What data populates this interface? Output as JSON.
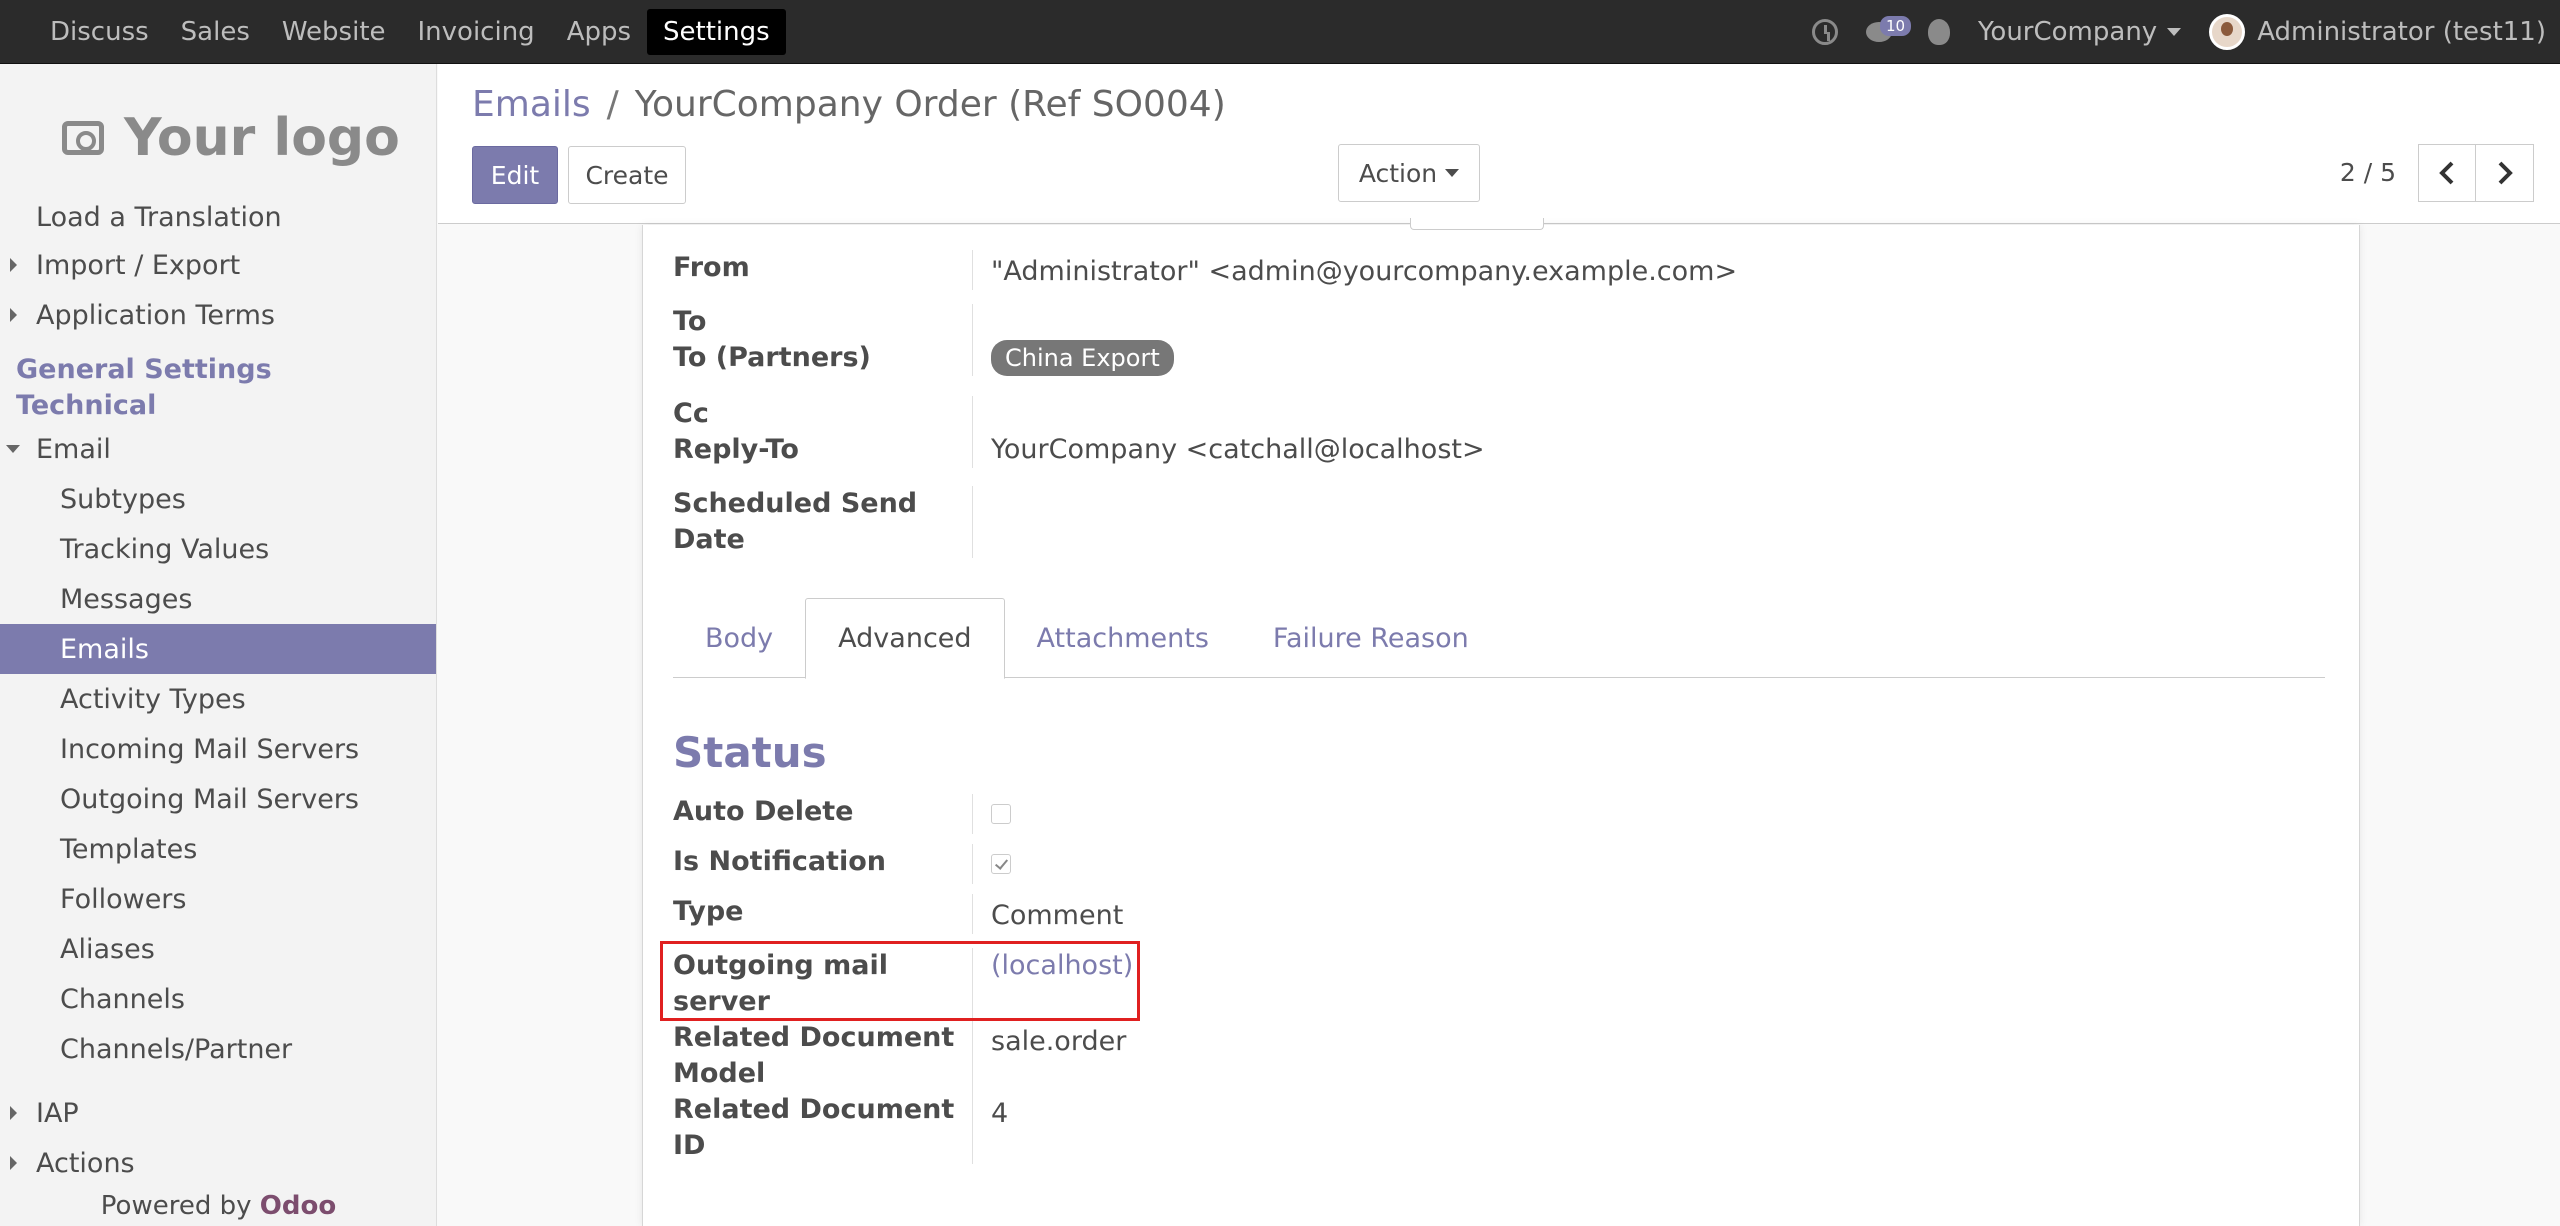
{
  "topbar": {
    "menu": [
      "Discuss",
      "Sales",
      "Website",
      "Invoicing",
      "Apps",
      "Settings"
    ],
    "active": "Settings",
    "message_count": "10",
    "company": "YourCompany",
    "user": "Administrator (test11)"
  },
  "sidebar": {
    "logo_text": "Your logo",
    "items_top": [
      {
        "label": "Load a Translation",
        "expandable": false
      },
      {
        "label": "Import / Export",
        "expandable": true
      },
      {
        "label": "Application Terms",
        "expandable": true
      }
    ],
    "categories": [
      "General Settings",
      "Technical"
    ],
    "email_group": "Email",
    "email_items": [
      "Subtypes",
      "Tracking Values",
      "Messages",
      "Emails",
      "Activity Types",
      "Incoming Mail Servers",
      "Outgoing Mail Servers",
      "Templates",
      "Followers",
      "Aliases",
      "Channels",
      "Channels/Partner"
    ],
    "active_item": "Emails",
    "items_bottom": [
      "IAP",
      "Actions"
    ],
    "powered_by": "Powered by",
    "powered_brand": "Odoo"
  },
  "control_panel": {
    "breadcrumb_parent": "Emails",
    "breadcrumb_sep": "/",
    "breadcrumb_current": "YourCompany Order (Ref SO004)",
    "edit_label": "Edit",
    "create_label": "Create",
    "action_label": "Action",
    "pager": "2 / 5"
  },
  "form": {
    "from_label": "From",
    "from_value": "\"Administrator\" <admin@yourcompany.example.com>",
    "to_label": "To",
    "to_partners_label": "To (Partners)",
    "to_partners_tag": "China Export",
    "cc_label": "Cc",
    "reply_to_label": "Reply-To",
    "reply_to_value": "YourCompany <catchall@localhost>",
    "scheduled_label_1": "Scheduled Send",
    "scheduled_label_2": "Date",
    "tabs": [
      "Body",
      "Advanced",
      "Attachments",
      "Failure Reason"
    ],
    "active_tab": "Advanced",
    "status_title": "Status",
    "auto_delete_label": "Auto Delete",
    "auto_delete": false,
    "is_notification_label": "Is Notification",
    "is_notification": true,
    "type_label": "Type",
    "type_value": "Comment",
    "outgoing_label_1": "Outgoing mail",
    "outgoing_label_2": "server",
    "outgoing_value": "(localhost)",
    "rel_model_label_1": "Related Document",
    "rel_model_label_2": "Model",
    "rel_model_value": "sale.order",
    "rel_id_label_1": "Related Document",
    "rel_id_label_2": "ID",
    "rel_id_value": "4"
  }
}
